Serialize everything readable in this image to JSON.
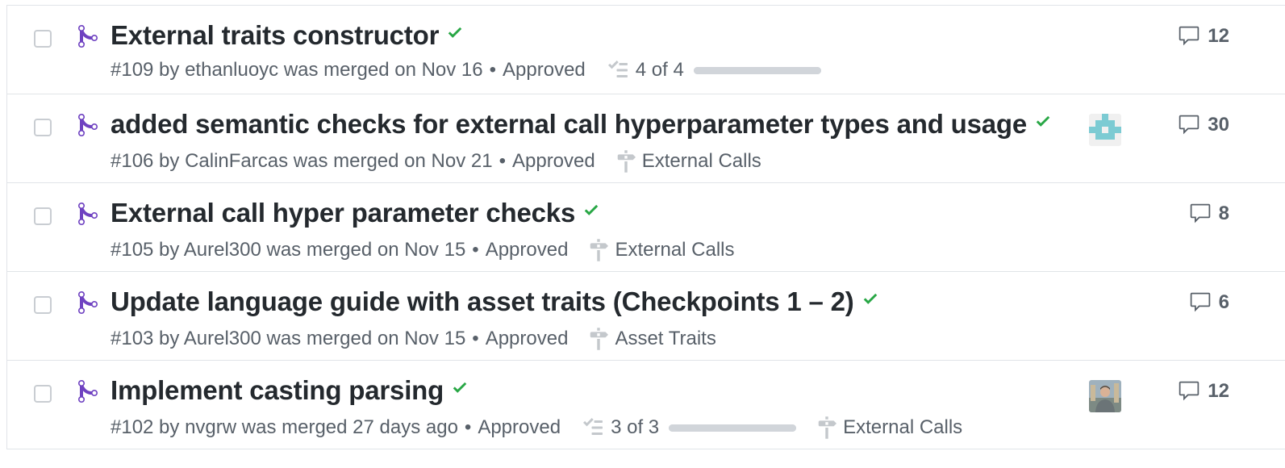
{
  "pull_requests": [
    {
      "title": "External traits constructor",
      "meta": "#109 by ethanluoyc was merged on Nov 16",
      "review": "Approved",
      "tasks": "4 of 4",
      "task_progress": 1.0,
      "label": "",
      "comments": "12",
      "avatar": ""
    },
    {
      "title": "added semantic checks for external call hyperparameter types and usage",
      "meta": "#106 by CalinFarcas was merged on Nov 21",
      "review": "Approved",
      "tasks": "",
      "label": "External Calls",
      "comments": "30",
      "avatar": "identicon"
    },
    {
      "title": "External call hyper parameter checks",
      "meta": "#105 by Aurel300 was merged on Nov 15",
      "review": "Approved",
      "tasks": "",
      "label": "External Calls",
      "comments": "8",
      "avatar": ""
    },
    {
      "title": "Update language guide with asset traits (Checkpoints 1 – 2)",
      "meta": "#103 by Aurel300 was merged on Nov 15",
      "review": "Approved",
      "tasks": "",
      "label": "Asset Traits",
      "comments": "6",
      "avatar": ""
    },
    {
      "title": "Implement casting parsing",
      "meta": "#102 by nvgrw was merged 27 days ago",
      "review": "Approved",
      "tasks": "3 of 3",
      "task_progress": 1.0,
      "label": "External Calls",
      "comments": "12",
      "avatar": "photo"
    }
  ],
  "colors": {
    "merged_purple": "#6f42c1",
    "success_green": "#28a745",
    "muted_text": "#586069",
    "border": "#e1e4e8"
  },
  "icons": {
    "merge": "git-merge-icon",
    "check": "check-icon",
    "tasklist": "tasklist-icon",
    "milestone": "milestone-icon",
    "comment": "comment-icon"
  }
}
